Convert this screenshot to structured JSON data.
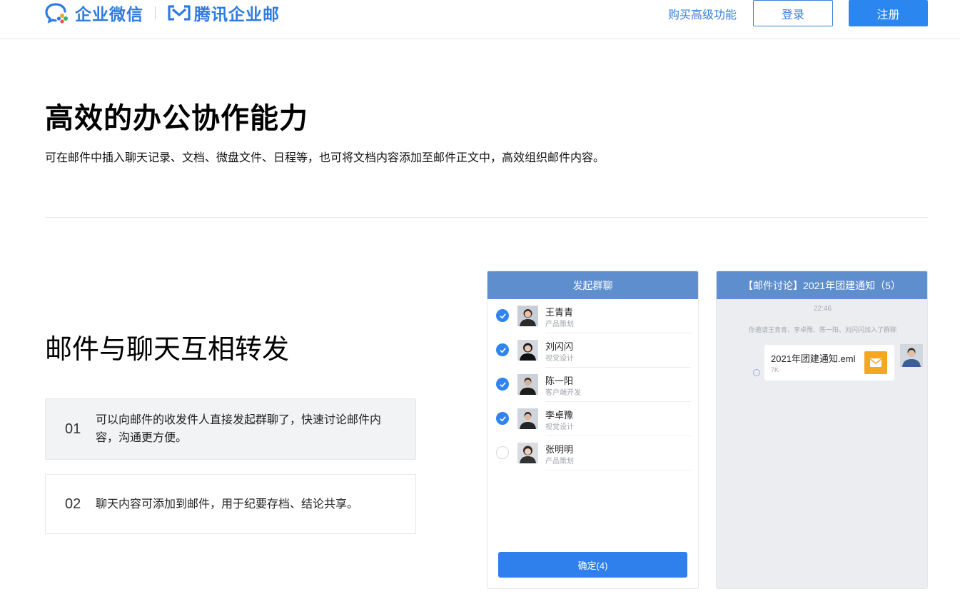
{
  "header": {
    "brand_wework": "企业微信",
    "brand_mail": "腾讯企业邮",
    "nav_link": "购买高级功能",
    "login_label": "登录",
    "signup_label": "注册"
  },
  "hero": {
    "title": "高效的办公协作能力",
    "description": "可在邮件中插入聊天记录、文档、微盘文件、日程等，也可将文档内容添加至邮件正文中，高效组织邮件内容。"
  },
  "feature": {
    "title": "邮件与聊天互相转发",
    "items": [
      {
        "num": "01",
        "text": "可以向邮件的收发件人直接发起群聊了，快速讨论邮件内容，沟通更方便。"
      },
      {
        "num": "02",
        "text": "聊天内容可添加到邮件，用于纪要存档、结论共享。"
      }
    ]
  },
  "group_chat_mock": {
    "title": "发起群聊",
    "contacts": [
      {
        "name": "王青青",
        "role": "产品策划",
        "checked": true
      },
      {
        "name": "刘闪闪",
        "role": "视觉设计",
        "checked": true
      },
      {
        "name": "陈一阳",
        "role": "客户端开发",
        "checked": true
      },
      {
        "name": "李卓豫",
        "role": "视觉设计",
        "checked": true
      },
      {
        "name": "张明明",
        "role": "产品策划",
        "checked": false
      }
    ],
    "confirm_label": "确定(4)"
  },
  "chat_mock": {
    "title": "【邮件讨论】2021年团建通知（5）",
    "time": "22:46",
    "system_message": "你邀请王青青、李卓豫、陈一阳、刘闪闪加入了群聊",
    "file_name": "2021年团建通知.eml",
    "file_size": "7K"
  },
  "colors": {
    "brand_blue": "#2f7be0",
    "primary_button": "#2c86f0",
    "mock_header": "#5e8ecd",
    "file_icon": "#f5a623"
  }
}
